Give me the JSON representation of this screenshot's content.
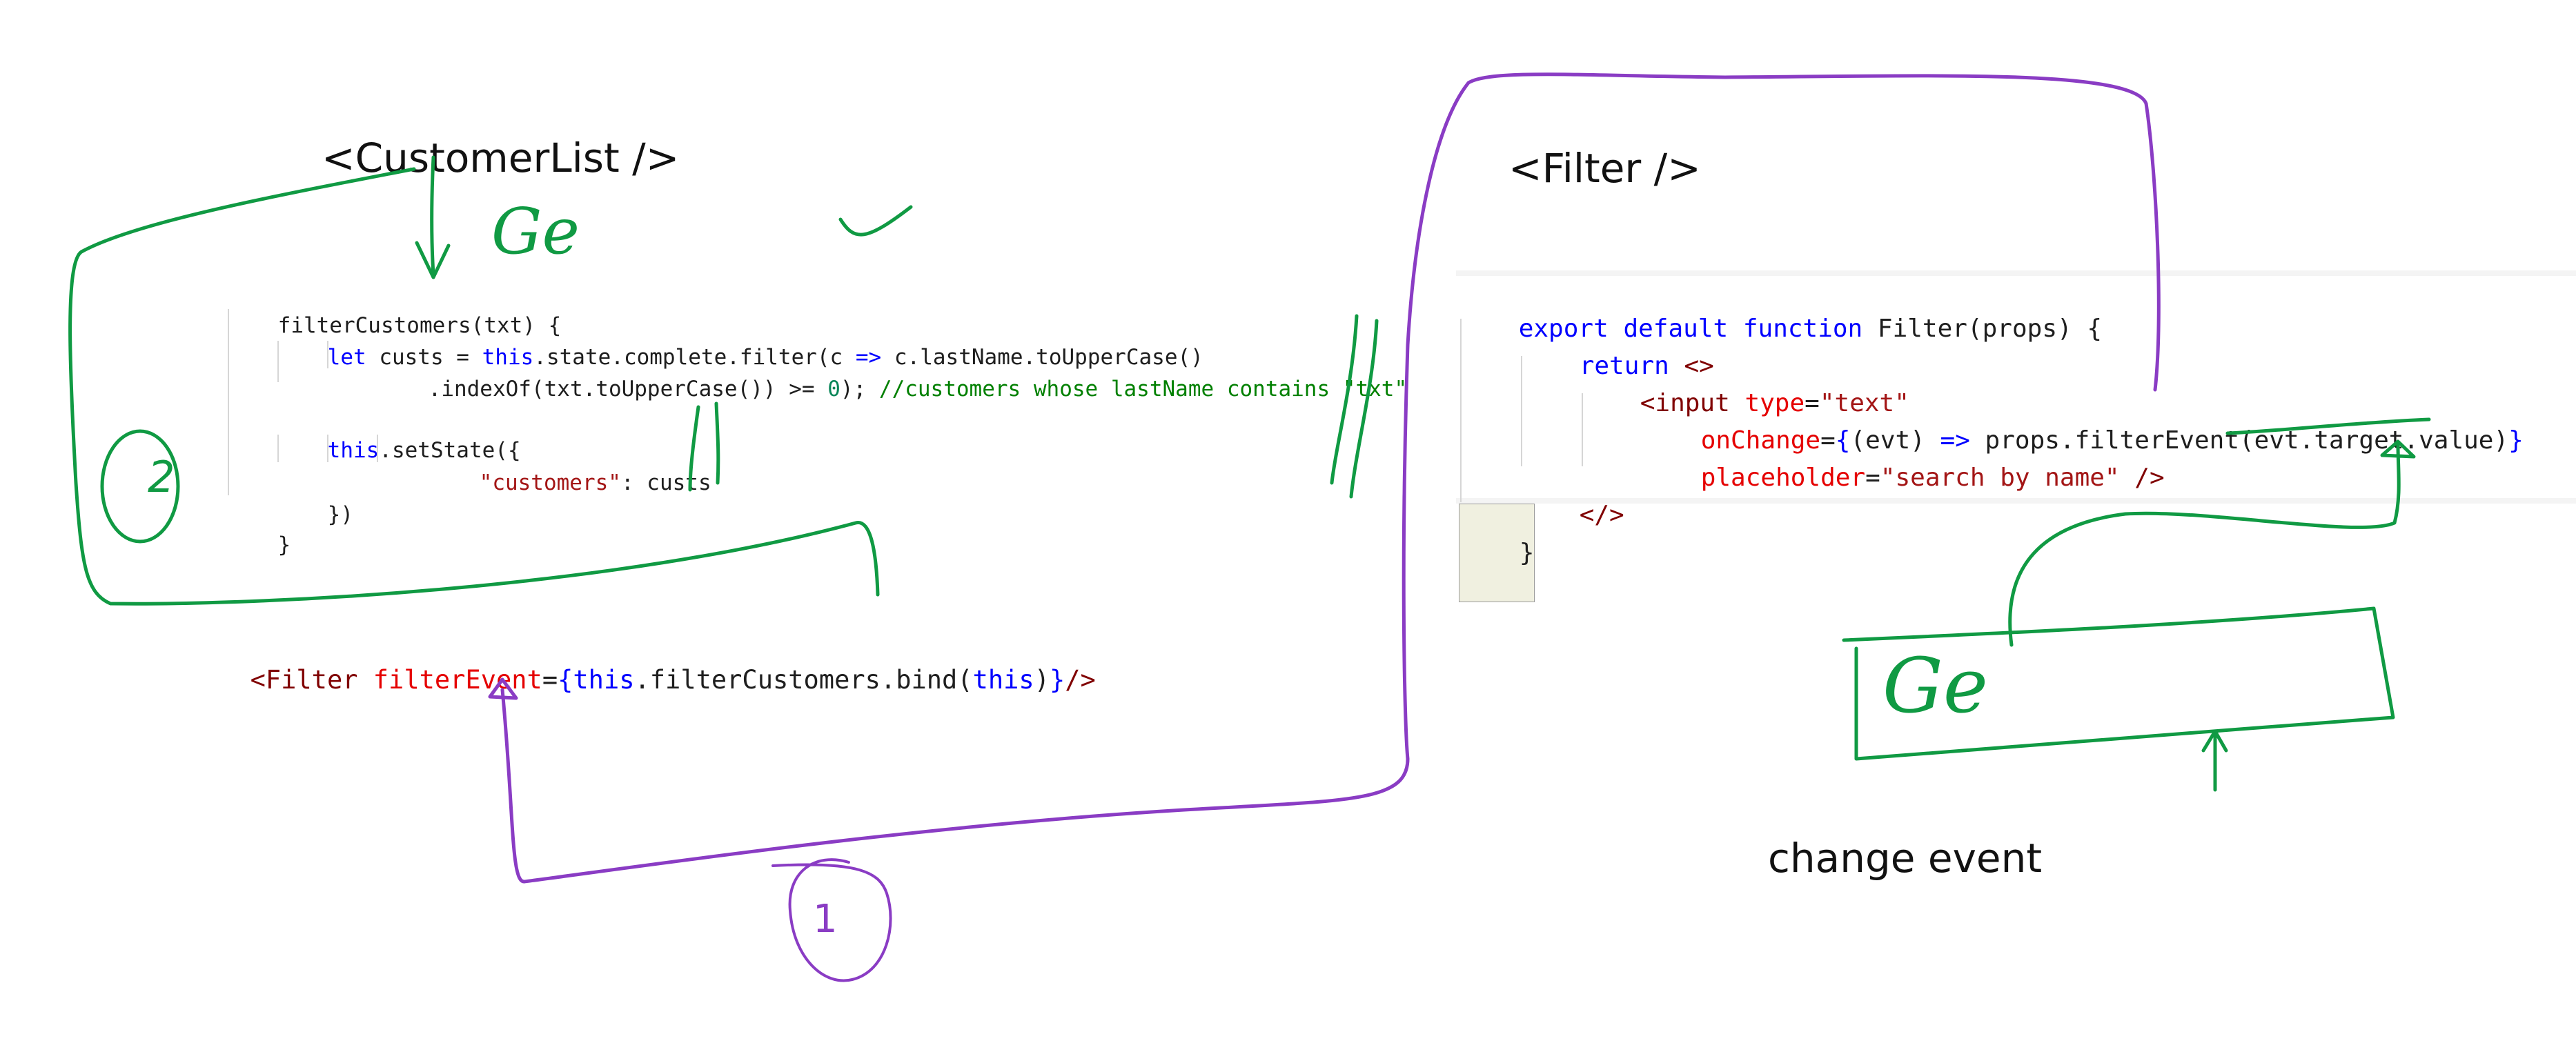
{
  "labels": {
    "customer_list": "<CustomerList />",
    "filter": "<Filter />",
    "change_event": "change event",
    "input_text": "Ge",
    "top_scribble": "Ge",
    "circle_1": "1",
    "circle_2": "2"
  },
  "left_code": [
    [
      "filterCustomers(txt) {"
    ],
    [
      "let",
      " custs = ",
      "this",
      ".state.complete.filter(c ",
      "=>",
      " c.lastName.toUpperCase()"
    ],
    [
      ".indexOf(txt.toUpperCase()) >= ",
      "0",
      "); ",
      "//customers whose lastName contains \"txt\""
    ],
    [
      ""
    ],
    [
      "this",
      ".setState({"
    ],
    [
      "\"customers\"",
      ": custs"
    ],
    [
      "})"
    ],
    [
      "}"
    ]
  ],
  "filter_line": [
    "<",
    "Filter ",
    "filterEvent",
    "=",
    "{",
    "this",
    ".filterCustomers.bind(",
    "this",
    ")",
    "}",
    "/>"
  ],
  "right_code": [
    [
      "export",
      " ",
      "default",
      " ",
      "function",
      " Filter(props) {"
    ],
    [
      "return",
      " ",
      "<>"
    ],
    [
      "<",
      "input",
      " ",
      "type",
      "=",
      "\"text\""
    ],
    [
      "onChange",
      "=",
      "{",
      "(evt) ",
      "=>",
      " props.filterEvent(evt.target.value)",
      "}"
    ],
    [
      "placeholder",
      "=",
      "\"search by name\"",
      " />"
    ],
    [
      "</>"
    ],
    [
      "}"
    ]
  ],
  "colors": {
    "green_ink": "#109a43",
    "purple_ink": "#8a3cc4",
    "keyword": "#0000ff",
    "string": "#a31515",
    "comment": "#008000",
    "number": "#098658",
    "jsx_tag": "#800000",
    "jsx_attr": "#e50000"
  }
}
